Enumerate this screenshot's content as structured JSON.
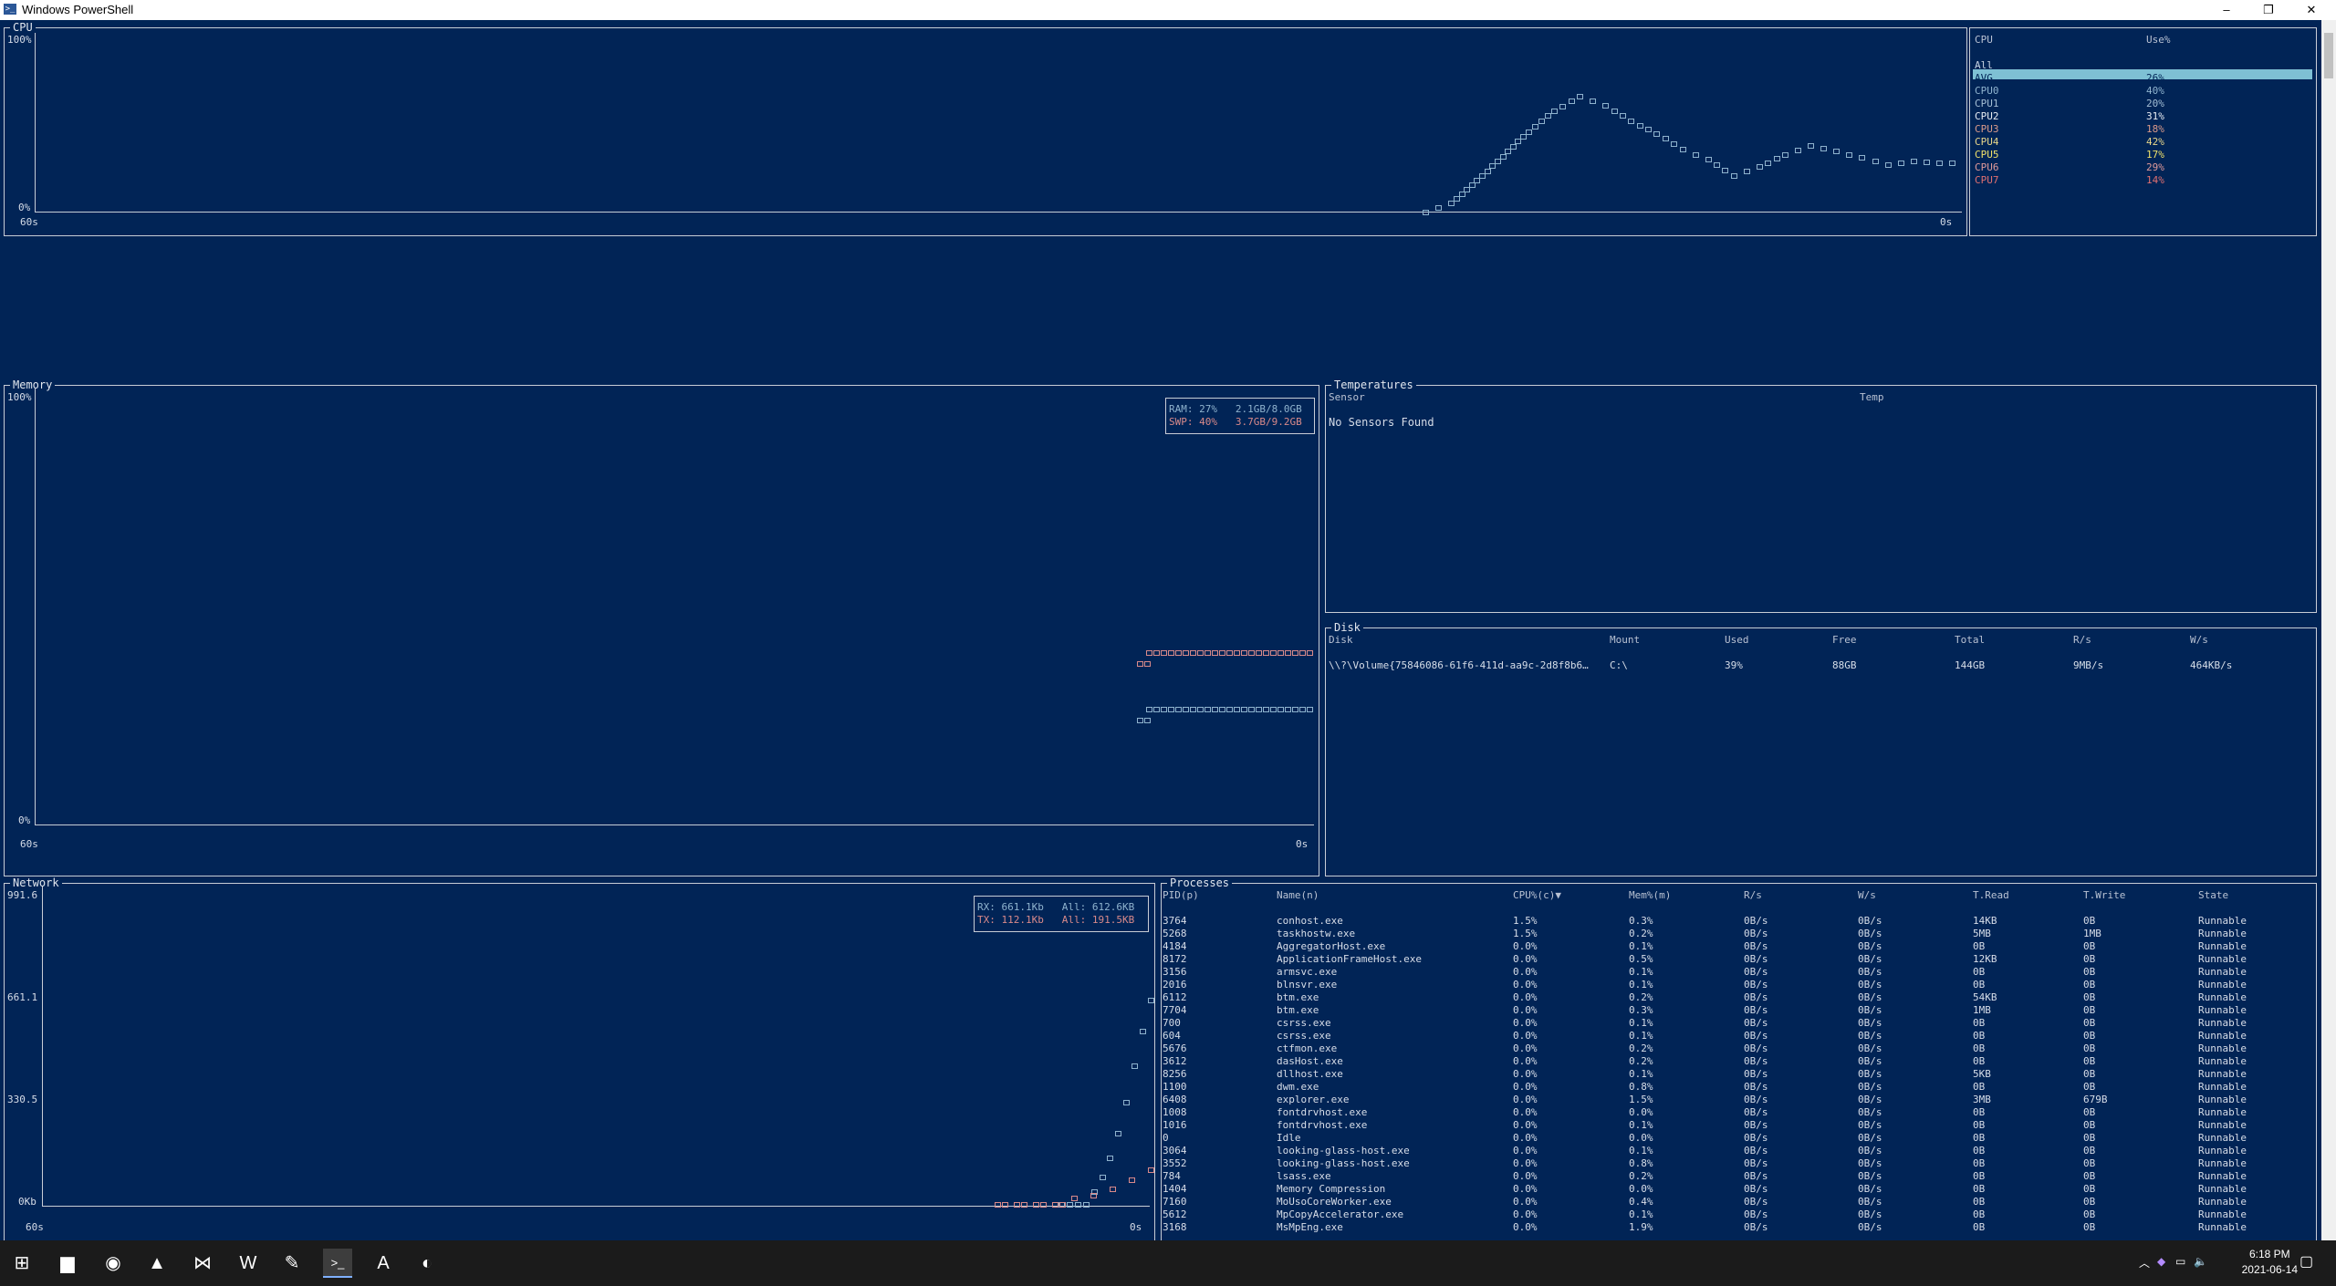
{
  "window": {
    "title": "Windows PowerShell",
    "icon": "powershell-icon",
    "controls": [
      "–",
      "❐",
      "✕"
    ]
  },
  "colors": {
    "background": "#012456",
    "cpu_highlight": "#7ec0d4",
    "swap": "#d98a8a",
    "ram": "#8fb3ce"
  },
  "cpu": {
    "title": "CPU",
    "y_max": "100%",
    "y_min": "0%",
    "x_start": "60s",
    "x_end": "0s",
    "table_headers": [
      "CPU",
      "Use%"
    ],
    "rows": [
      {
        "name": "All",
        "use": "",
        "color": "#c9d4e3"
      },
      {
        "name": "AVG",
        "use": "26%",
        "color": "#012456"
      },
      {
        "name": "CPU0",
        "use": "40%",
        "color": "#8fb3ce"
      },
      {
        "name": "CPU1",
        "use": "20%",
        "color": "#a4bed4"
      },
      {
        "name": "CPU2",
        "use": "31%",
        "color": "#e8ecf2"
      },
      {
        "name": "CPU3",
        "use": "18%",
        "color": "#d99a8a"
      },
      {
        "name": "CPU4",
        "use": "42%",
        "color": "#e8d68a"
      },
      {
        "name": "CPU5",
        "use": "17%",
        "color": "#f0e06a"
      },
      {
        "name": "CPU6",
        "use": "29%",
        "color": "#e09a9a"
      },
      {
        "name": "CPU7",
        "use": "14%",
        "color": "#e07070"
      }
    ],
    "chart_data": {
      "type": "line",
      "series": [
        {
          "values": [
            0,
            0,
            0,
            0,
            0,
            0,
            0,
            0,
            0,
            0,
            0,
            0,
            0,
            0,
            0,
            0,
            0,
            0,
            0,
            0,
            0,
            0,
            0,
            0,
            0,
            0,
            0,
            0,
            0,
            0,
            0,
            0,
            0,
            0,
            0,
            0,
            0,
            0,
            0,
            0,
            0,
            0,
            0,
            0,
            0,
            0,
            0,
            0,
            0,
            0,
            0,
            0,
            0,
            0,
            0,
            5,
            18,
            32,
            46,
            58,
            66,
            61,
            52,
            45,
            36,
            30,
            21,
            26,
            33,
            38,
            35,
            31,
            27,
            29,
            28,
            28
          ]
        }
      ],
      "xlim": [
        60,
        0
      ],
      "ylim": [
        0,
        100
      ]
    }
  },
  "memory": {
    "title": "Memory",
    "y_max": "100%",
    "y_min": "0%",
    "x_start": "60s",
    "x_end": "0s",
    "legend": {
      "ram": "RAM: 27%   2.1GB/8.0GB",
      "swp": "SWP: 40%   3.7GB/9.2GB"
    },
    "chart_data": {
      "type": "line",
      "series": [
        {
          "name": "RAM",
          "values": [
            27
          ]
        },
        {
          "name": "SWP",
          "values": [
            40
          ]
        }
      ],
      "ylim": [
        0,
        100
      ]
    }
  },
  "temperatures": {
    "title": "Temperatures",
    "headers": [
      "Sensor",
      "Temp"
    ],
    "message": "No Sensors Found"
  },
  "disk": {
    "title": "Disk",
    "headers": [
      "Disk",
      "Mount",
      "Used",
      "Free",
      "Total",
      "R/s",
      "W/s"
    ],
    "rows": [
      [
        "\\\\?\\Volume{75846086-61f6-411d-aa9c-2d8f8b6…",
        "C:\\",
        "39%",
        "88GB",
        "144GB",
        "9MB/s",
        "464KB/s"
      ]
    ]
  },
  "network": {
    "title": "Network",
    "y_labels": [
      "991.6",
      "661.1",
      "330.5",
      "0Kb"
    ],
    "x_start": "60s",
    "x_end": "0s",
    "legend": {
      "rx": "RX: 661.1Kb   All: 612.6KB",
      "tx": "TX: 112.1Kb   All: 191.5KB"
    },
    "chart_data": {
      "type": "line",
      "series": [
        {
          "name": "RX",
          "values": [
            0,
            0,
            0,
            0,
            40,
            90,
            150,
            230,
            330,
            450,
            560,
            661
          ]
        },
        {
          "name": "TX",
          "values": [
            0,
            0,
            0,
            0,
            20,
            30,
            50,
            80,
            112
          ]
        }
      ],
      "ylim": [
        0,
        991.6
      ]
    }
  },
  "processes": {
    "title": "Processes",
    "headers": [
      "PID(p)",
      "Name(n)",
      "CPU%(c)▼",
      "Mem%(m)",
      "R/s",
      "W/s",
      "T.Read",
      "T.Write",
      "State"
    ],
    "rows": [
      [
        "3764",
        "conhost.exe",
        "1.5%",
        "0.3%",
        "0B/s",
        "0B/s",
        "14KB",
        "0B",
        "Runnable"
      ],
      [
        "5268",
        "taskhostw.exe",
        "1.5%",
        "0.2%",
        "0B/s",
        "0B/s",
        "5MB",
        "1MB",
        "Runnable"
      ],
      [
        "4184",
        "AggregatorHost.exe",
        "0.0%",
        "0.1%",
        "0B/s",
        "0B/s",
        "0B",
        "0B",
        "Runnable"
      ],
      [
        "8172",
        "ApplicationFrameHost.exe",
        "0.0%",
        "0.5%",
        "0B/s",
        "0B/s",
        "12KB",
        "0B",
        "Runnable"
      ],
      [
        "3156",
        "armsvc.exe",
        "0.0%",
        "0.1%",
        "0B/s",
        "0B/s",
        "0B",
        "0B",
        "Runnable"
      ],
      [
        "2016",
        "blnsvr.exe",
        "0.0%",
        "0.1%",
        "0B/s",
        "0B/s",
        "0B",
        "0B",
        "Runnable"
      ],
      [
        "6112",
        "btm.exe",
        "0.0%",
        "0.2%",
        "0B/s",
        "0B/s",
        "54KB",
        "0B",
        "Runnable"
      ],
      [
        "7704",
        "btm.exe",
        "0.0%",
        "0.3%",
        "0B/s",
        "0B/s",
        "1MB",
        "0B",
        "Runnable"
      ],
      [
        "700",
        "csrss.exe",
        "0.0%",
        "0.1%",
        "0B/s",
        "0B/s",
        "0B",
        "0B",
        "Runnable"
      ],
      [
        "604",
        "csrss.exe",
        "0.0%",
        "0.1%",
        "0B/s",
        "0B/s",
        "0B",
        "0B",
        "Runnable"
      ],
      [
        "5676",
        "ctfmon.exe",
        "0.0%",
        "0.2%",
        "0B/s",
        "0B/s",
        "0B",
        "0B",
        "Runnable"
      ],
      [
        "3612",
        "dasHost.exe",
        "0.0%",
        "0.2%",
        "0B/s",
        "0B/s",
        "0B",
        "0B",
        "Runnable"
      ],
      [
        "8256",
        "dllhost.exe",
        "0.0%",
        "0.1%",
        "0B/s",
        "0B/s",
        "5KB",
        "0B",
        "Runnable"
      ],
      [
        "1100",
        "dwm.exe",
        "0.0%",
        "0.8%",
        "0B/s",
        "0B/s",
        "0B",
        "0B",
        "Runnable"
      ],
      [
        "6408",
        "explorer.exe",
        "0.0%",
        "1.5%",
        "0B/s",
        "0B/s",
        "3MB",
        "679B",
        "Runnable"
      ],
      [
        "1008",
        "fontdrvhost.exe",
        "0.0%",
        "0.0%",
        "0B/s",
        "0B/s",
        "0B",
        "0B",
        "Runnable"
      ],
      [
        "1016",
        "fontdrvhost.exe",
        "0.0%",
        "0.1%",
        "0B/s",
        "0B/s",
        "0B",
        "0B",
        "Runnable"
      ],
      [
        "0",
        "Idle",
        "0.0%",
        "0.0%",
        "0B/s",
        "0B/s",
        "0B",
        "0B",
        "Runnable"
      ],
      [
        "3064",
        "looking-glass-host.exe",
        "0.0%",
        "0.1%",
        "0B/s",
        "0B/s",
        "0B",
        "0B",
        "Runnable"
      ],
      [
        "3552",
        "looking-glass-host.exe",
        "0.0%",
        "0.8%",
        "0B/s",
        "0B/s",
        "0B",
        "0B",
        "Runnable"
      ],
      [
        "784",
        "lsass.exe",
        "0.0%",
        "0.2%",
        "0B/s",
        "0B/s",
        "0B",
        "0B",
        "Runnable"
      ],
      [
        "1404",
        "Memory Compression",
        "0.0%",
        "0.0%",
        "0B/s",
        "0B/s",
        "0B",
        "0B",
        "Runnable"
      ],
      [
        "7160",
        "MoUsoCoreWorker.exe",
        "0.0%",
        "0.4%",
        "0B/s",
        "0B/s",
        "0B",
        "0B",
        "Runnable"
      ],
      [
        "5612",
        "MpCopyAccelerator.exe",
        "0.0%",
        "0.1%",
        "0B/s",
        "0B/s",
        "0B",
        "0B",
        "Runnable"
      ],
      [
        "3168",
        "MsMpEng.exe",
        "0.0%",
        "1.9%",
        "0B/s",
        "0B/s",
        "0B",
        "0B",
        "Runnable"
      ]
    ]
  },
  "taskbar": {
    "apps": [
      {
        "name": "start-icon",
        "glyph": "⊞"
      },
      {
        "name": "file-explorer-icon",
        "glyph": "▆"
      },
      {
        "name": "firefox-icon",
        "glyph": "◉"
      },
      {
        "name": "photos-icon",
        "glyph": "▲"
      },
      {
        "name": "vscode-icon",
        "glyph": "⋈"
      },
      {
        "name": "word-icon",
        "glyph": "W"
      },
      {
        "name": "notepadpp-icon",
        "glyph": "✎"
      },
      {
        "name": "powershell-icon",
        "glyph": ">_"
      },
      {
        "name": "alacritty-icon",
        "glyph": "A"
      },
      {
        "name": "edge-icon",
        "glyph": "◐"
      }
    ],
    "clock_time": "6:18 PM",
    "clock_date": "2021-06-14"
  }
}
